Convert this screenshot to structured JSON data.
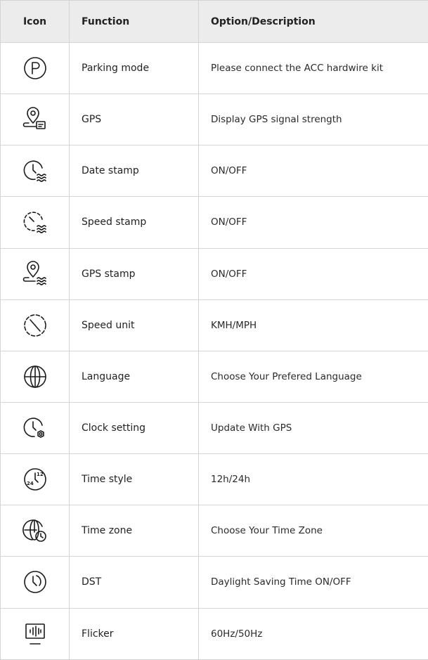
{
  "header": {
    "icon": "Icon",
    "function": "Function",
    "description": "Option/Description"
  },
  "rows": [
    {
      "icon": "parking-p-icon",
      "function": "Parking mode",
      "description": "Please connect the ACC hardwire kit"
    },
    {
      "icon": "gps-pin-card-icon",
      "function": "GPS",
      "description": "Display GPS signal strength"
    },
    {
      "icon": "clock-waves-icon",
      "function": "Date stamp",
      "description": "ON/OFF"
    },
    {
      "icon": "speedometer-waves-icon",
      "function": "Speed stamp",
      "description": "ON/OFF"
    },
    {
      "icon": "pin-waves-icon",
      "function": "GPS stamp",
      "description": "ON/OFF"
    },
    {
      "icon": "speedometer-icon",
      "function": "Speed unit",
      "description": "KMH/MPH"
    },
    {
      "icon": "globe-icon",
      "function": "Language",
      "description": "Choose Your Prefered Language"
    },
    {
      "icon": "clock-gear-icon",
      "function": "Clock setting",
      "description": "Update With GPS"
    },
    {
      "icon": "clock-12-24-icon",
      "function": "Time style",
      "description": "12h/24h",
      "icon_text": [
        "12",
        "24"
      ]
    },
    {
      "icon": "globe-clock-icon",
      "function": "Time zone",
      "description": "Choose Your Time Zone"
    },
    {
      "icon": "clock-dst-icon",
      "function": "DST",
      "description": "Daylight Saving Time ON/OFF"
    },
    {
      "icon": "monitor-flicker-icon",
      "function": "Flicker",
      "description": "60Hz/50Hz"
    }
  ]
}
